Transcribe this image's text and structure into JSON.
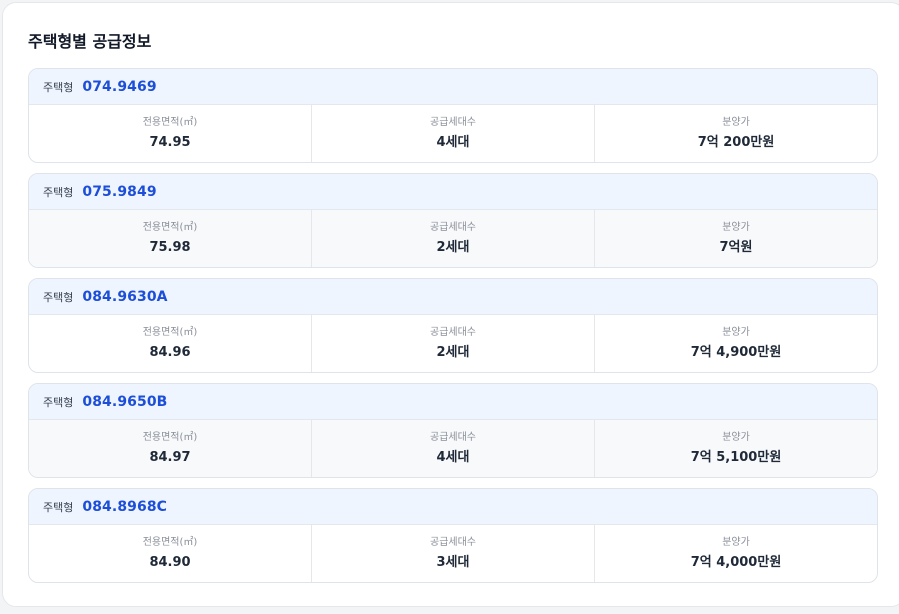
{
  "section": {
    "title": "주택형별 공급정보"
  },
  "labels": {
    "type": "주택형",
    "area": "전용면적(㎡)",
    "units": "공급세대수",
    "price": "분양가"
  },
  "items": [
    {
      "code": "074.9469",
      "area": "74.95",
      "units": "4세대",
      "price": "7억 200만원"
    },
    {
      "code": "075.9849",
      "area": "75.98",
      "units": "2세대",
      "price": "7억원"
    },
    {
      "code": "084.9630A",
      "area": "84.96",
      "units": "2세대",
      "price": "7억 4,900만원"
    },
    {
      "code": "084.9650B",
      "area": "84.97",
      "units": "4세대",
      "price": "7억 5,100만원"
    },
    {
      "code": "084.8968C",
      "area": "84.90",
      "units": "3세대",
      "price": "7억 4,000만원"
    }
  ]
}
